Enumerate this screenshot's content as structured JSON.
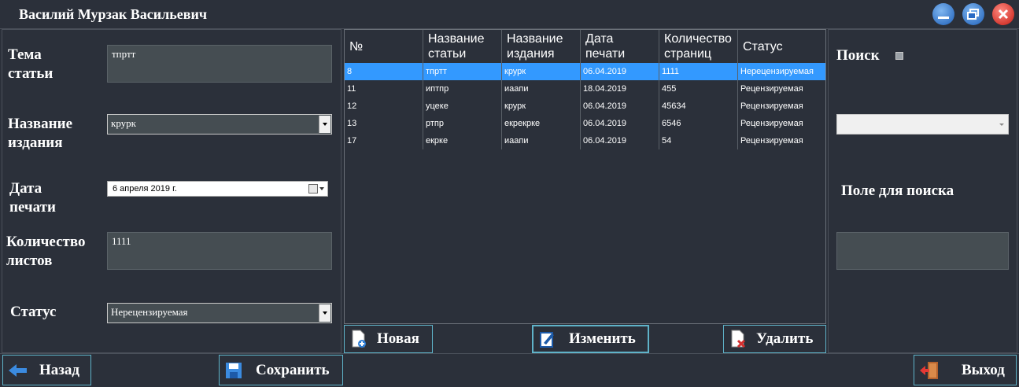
{
  "window": {
    "title": "Василий Мурзак Васильевич"
  },
  "form": {
    "topic_label_1": "Тема",
    "topic_label_2": "статьи",
    "topic_value": "тпртт",
    "edition_label_1": "Название",
    "edition_label_2": "издания",
    "edition_value": "крурк",
    "date_label_1": "Дата",
    "date_label_2": "печати",
    "date_value": "6  апреля  2019 г.",
    "sheets_label_1": "Количество",
    "sheets_label_2": "листов",
    "sheets_value": "1111",
    "status_label": "Статус",
    "status_value": "Нерецензируемая"
  },
  "table": {
    "headers": [
      {
        "l1": "№",
        "l2": ""
      },
      {
        "l1": "Название",
        "l2": "статьи"
      },
      {
        "l1": "Название",
        "l2": "издания"
      },
      {
        "l1": "Дата",
        "l2": "печати"
      },
      {
        "l1": "Количество",
        "l2": "страниц"
      },
      {
        "l1": "Статус",
        "l2": ""
      }
    ],
    "rows": [
      [
        "8",
        "тпртт",
        "крурк",
        "06.04.2019",
        "1111",
        "Нерецензируемая"
      ],
      [
        "11",
        "иптпр",
        "иаапи",
        "18.04.2019",
        "455",
        "Рецензируемая"
      ],
      [
        "12",
        "уцеке",
        "крурк",
        "06.04.2019",
        "45634",
        "Рецензируемая"
      ],
      [
        "13",
        "ртпр",
        "екрекрке",
        "06.04.2019",
        "6546",
        "Рецензируемая"
      ],
      [
        "17",
        "екрке",
        "иаапи",
        "06.04.2019",
        "54",
        "Рецензируемая"
      ]
    ],
    "selected_row": 0
  },
  "actions": {
    "new_label": "Новая",
    "edit_label": "Изменить",
    "delete_label": "Удалить"
  },
  "search": {
    "title": "Поиск",
    "field_label": "Поле для поиска",
    "dropdown_value": "",
    "input_value": ""
  },
  "bottom": {
    "back_label": "Назад",
    "save_label": "Сохранить",
    "exit_label": "Выход"
  },
  "colors": {
    "background": "#2b303a",
    "field": "#454d52",
    "accent_border": "#5fb3c9",
    "selection": "#3399ff"
  }
}
